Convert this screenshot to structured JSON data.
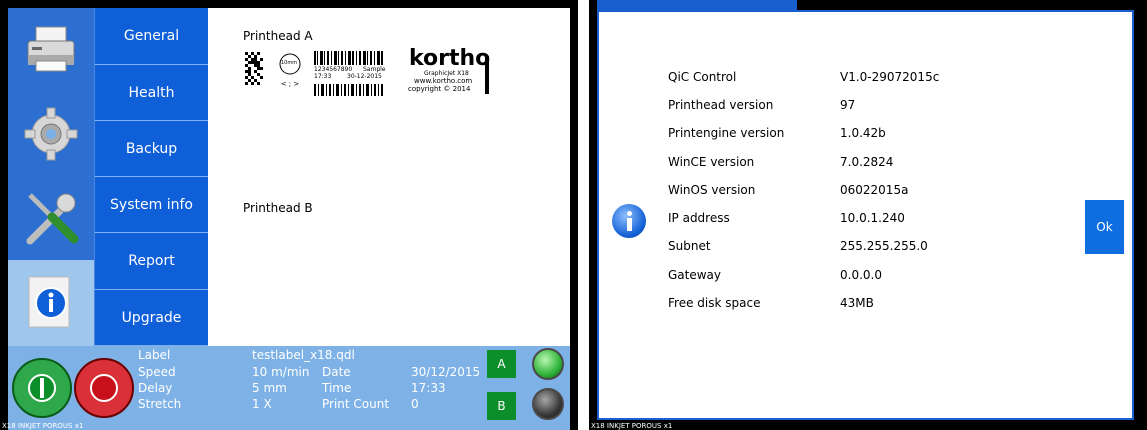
{
  "left": {
    "menu": [
      {
        "label": "General"
      },
      {
        "label": "Health"
      },
      {
        "label": "Backup"
      },
      {
        "label": "System info"
      },
      {
        "label": "Report"
      },
      {
        "label": "Upgrade"
      }
    ],
    "icons": [
      "printer-icon",
      "settings-gear-icon",
      "tools-icon",
      "info-icon"
    ],
    "content": {
      "printhead_a_title": "Printhead A",
      "printhead_b_title": "Printhead B",
      "label_preview": {
        "code_text": "1234567890",
        "sample": "Sample",
        "time": "17:33",
        "date": "30-12-2015",
        "size": "10mm",
        "brand": "kortho",
        "model": "GraphicJet X18",
        "url": "www.kortho.com",
        "copyright": "copyright © 2014"
      }
    },
    "status": {
      "label_key": "Label",
      "label_val": "testlabel_x18.qdl",
      "speed_key": "Speed",
      "speed_val": "10 m/min",
      "delay_key": "Delay",
      "delay_val": "5 mm",
      "stretch_key": "Stretch",
      "stretch_val": "1 X",
      "date_key": "Date",
      "date_val": "30/12/2015",
      "time_key": "Time",
      "time_val": "17:33",
      "count_key": "Print Count",
      "count_val": "0",
      "btn_a": "A",
      "btn_b": "B"
    },
    "footer": "X18 INKJET POROUS x1"
  },
  "right": {
    "rows": [
      {
        "label": "QiC Control",
        "value": "V1.0-29072015c"
      },
      {
        "label": "Printhead version",
        "value": "97"
      },
      {
        "label": "Printengine version",
        "value": "1.0.42b"
      },
      {
        "label": "WinCE version",
        "value": "7.0.2824"
      },
      {
        "label": "WinOS version",
        "value": "06022015a"
      },
      {
        "label": "IP address",
        "value": "10.0.1.240"
      },
      {
        "label": "Subnet",
        "value": "255.255.255.0"
      },
      {
        "label": "Gateway",
        "value": "0.0.0.0"
      },
      {
        "label": "Free disk space",
        "value": "43MB"
      }
    ],
    "ok_label": "Ok",
    "footer": "X18 INKJET POROUS x1"
  },
  "colors": {
    "menu_blue": "#0e5fd8",
    "status_blue": "#7eb2e6",
    "ok_blue": "#0e6ee0",
    "green": "#0c8e2a",
    "red": "#c8101a"
  }
}
